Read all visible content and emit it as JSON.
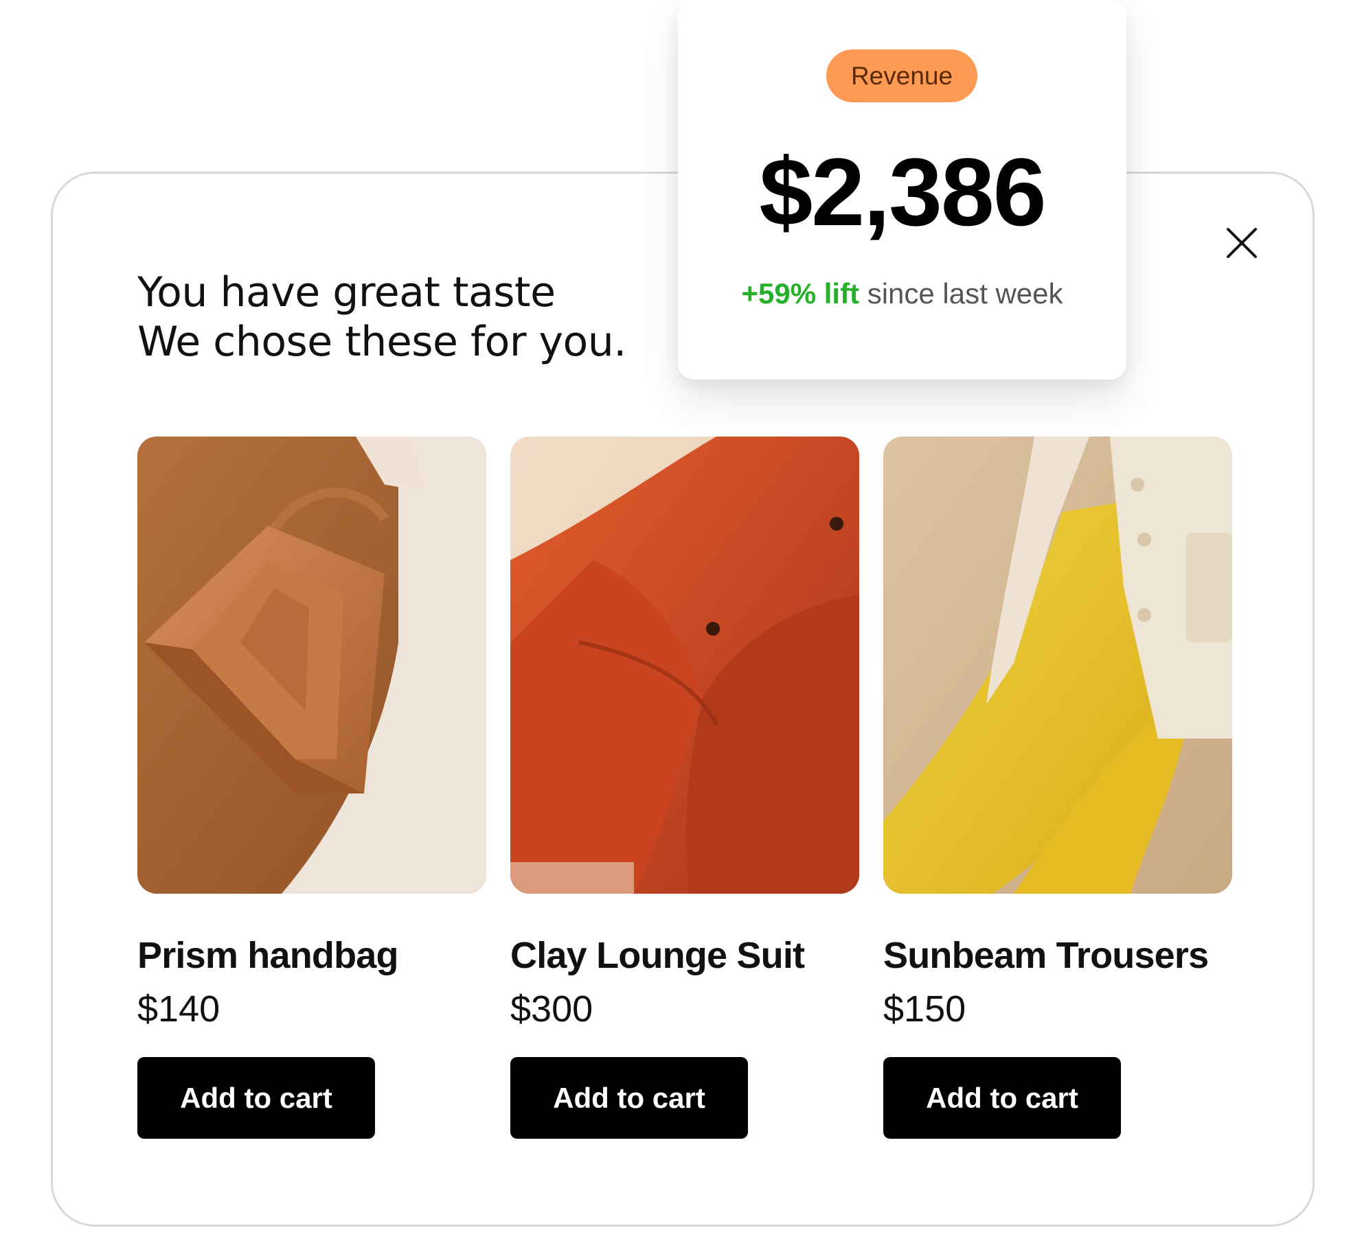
{
  "modal": {
    "headline_line1": "You have great taste",
    "headline_line2": "We chose these for you.",
    "close_icon": "close-icon"
  },
  "revenue": {
    "badge": "Revenue",
    "amount": "$2,386",
    "lift_value": "+59% lift",
    "lift_suffix": " since last week",
    "colors": {
      "badge": "#ff9a55",
      "lift": "#25b02a"
    }
  },
  "products": [
    {
      "name": "Prism handbag",
      "price": "$140",
      "button": "Add to cart",
      "image": "tan-leather-handbag-photo"
    },
    {
      "name": "Clay Lounge Suit",
      "price": "$300",
      "button": "Add to cart",
      "image": "rust-orange-suit-photo"
    },
    {
      "name": "Sunbeam Trousers",
      "price": "$150",
      "button": "Add to cart",
      "image": "yellow-trousers-cream-jacket-photo"
    }
  ]
}
